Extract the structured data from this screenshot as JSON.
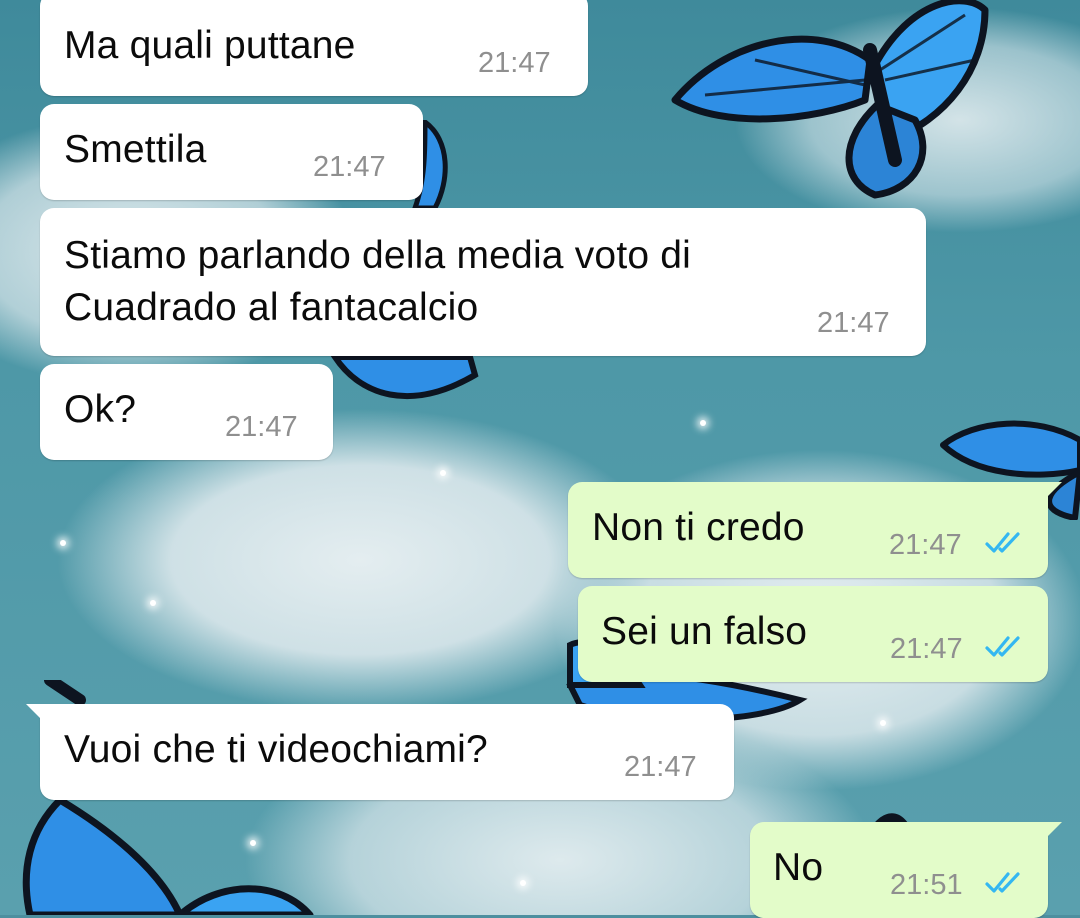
{
  "chat": {
    "messages": [
      {
        "direction": "incoming",
        "text": "Ma quali puttane",
        "time": "21:47"
      },
      {
        "direction": "incoming",
        "text": "Smettila",
        "time": "21:47"
      },
      {
        "direction": "incoming",
        "text": "Stiamo parlando della media voto di\nCuadrado al fantacalcio",
        "time": "21:47"
      },
      {
        "direction": "incoming",
        "text": "Ok?",
        "time": "21:47"
      },
      {
        "direction": "outgoing",
        "text": "Non ti credo",
        "time": "21:47",
        "status": "read",
        "status_icon": "double-check-icon"
      },
      {
        "direction": "outgoing",
        "text": "Sei un falso",
        "time": "21:47",
        "status": "read",
        "status_icon": "double-check-icon"
      },
      {
        "direction": "incoming",
        "text": "Vuoi che ti videochiami?",
        "time": "21:47"
      },
      {
        "direction": "outgoing",
        "text": "No",
        "time": "21:51",
        "status": "read",
        "status_icon": "double-check-icon"
      }
    ]
  },
  "theme": {
    "incoming_bubble": "#ffffff",
    "outgoing_bubble": "#e3fcc9",
    "read_check_color": "#34b7f1",
    "wallpaper": "blue-butterflies-glitter-clouds"
  }
}
